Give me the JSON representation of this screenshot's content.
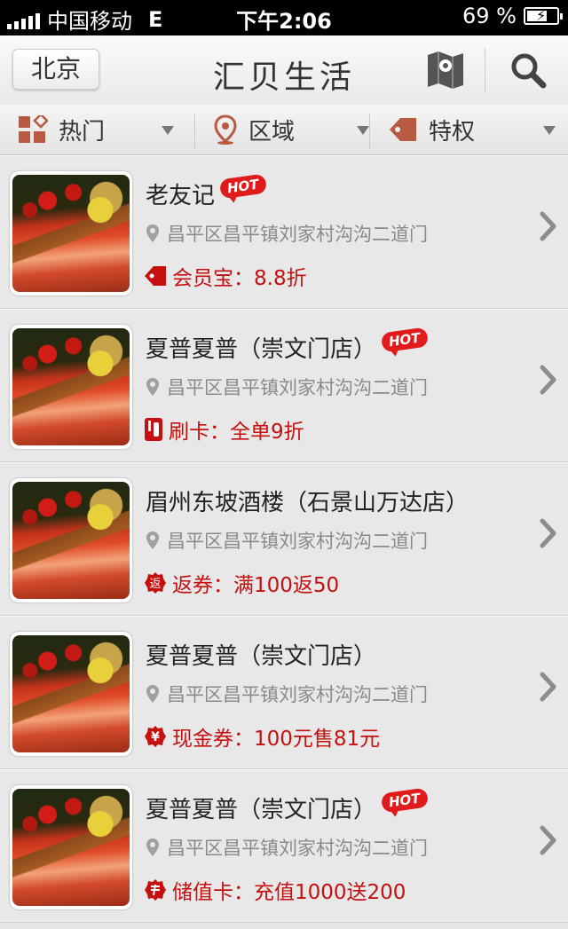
{
  "status_bar": {
    "carrier": "中国移动",
    "network": "E",
    "time": "下午2:06",
    "battery": "69 %",
    "battery_level": 0.69
  },
  "navbar": {
    "city": "北京",
    "title": "汇贝生活"
  },
  "filters": [
    {
      "label": "热门"
    },
    {
      "label": "区域"
    },
    {
      "label": "特权"
    }
  ],
  "hot_label": "HOT",
  "listings": [
    {
      "name": "老友记",
      "hot": true,
      "address": "昌平区昌平镇刘家村沟沟二道门",
      "promo_icon": "tag-icon",
      "promo": "会员宝：8.8折"
    },
    {
      "name": "夏普夏普（崇文门店）",
      "hot": true,
      "address": "昌平区昌平镇刘家村沟沟二道门",
      "promo_icon": "card-icon",
      "promo": "刷卡：全单9折"
    },
    {
      "name": "眉州东坡酒楼（石景山万达店）",
      "hot": false,
      "address": "昌平区昌平镇刘家村沟沟二道门",
      "promo_icon": "return-coupon-icon",
      "promo": "返券：满100返50"
    },
    {
      "name": "夏普夏普（崇文门店）",
      "hot": false,
      "address": "昌平区昌平镇刘家村沟沟二道门",
      "promo_icon": "yuan-coupon-icon",
      "promo": "现金券：100元售81元"
    },
    {
      "name": "夏普夏普（崇文门店）",
      "hot": true,
      "address": "昌平区昌平镇刘家村沟沟二道门",
      "promo_icon": "stored-value-icon",
      "promo": "储值卡：充值1000送200"
    }
  ],
  "colors": {
    "accent_red": "#c61010",
    "filter_icon": "#b85a42"
  }
}
